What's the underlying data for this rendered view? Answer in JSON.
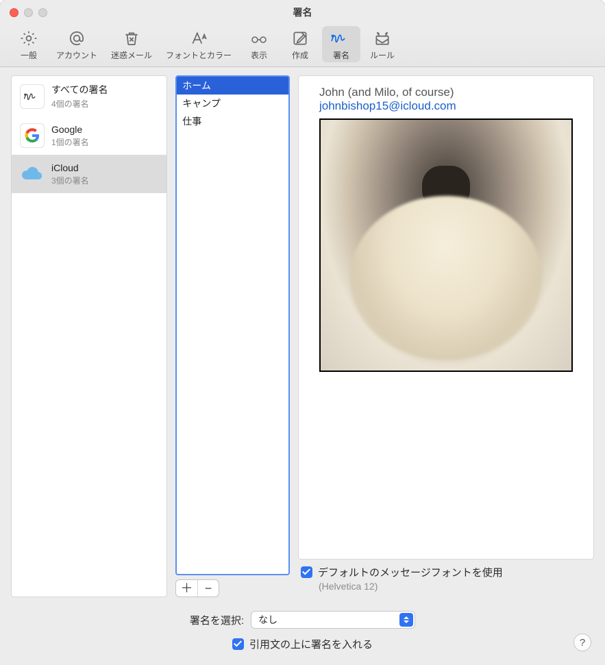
{
  "window": {
    "title": "署名"
  },
  "toolbar": {
    "items": [
      {
        "label": "一般"
      },
      {
        "label": "アカウント"
      },
      {
        "label": "迷惑メール"
      },
      {
        "label": "フォントとカラー"
      },
      {
        "label": "表示"
      },
      {
        "label": "作成"
      },
      {
        "label": "署名"
      },
      {
        "label": "ルール"
      }
    ],
    "selected_index": 6
  },
  "accounts": {
    "items": [
      {
        "name": "すべての署名",
        "subtitle": "4個の署名"
      },
      {
        "name": "Google",
        "subtitle": "1個の署名"
      },
      {
        "name": "iCloud",
        "subtitle": "3個の署名"
      }
    ],
    "selected_index": 2
  },
  "signatures": {
    "items": [
      "ホーム",
      "キャンプ",
      "仕事"
    ],
    "selected_index": 0
  },
  "preview": {
    "name_line": "John (and Milo, of course)",
    "email": "johnbishop15@icloud.com",
    "image_alt": "dog-photo"
  },
  "options": {
    "use_default_font_label": "デフォルトのメッセージフォントを使用",
    "use_default_font_checked": true,
    "default_font_note": "(Helvetica 12)"
  },
  "footer": {
    "select_label": "署名を選択:",
    "select_value": "なし",
    "above_quote_label": "引用文の上に署名を入れる",
    "above_quote_checked": true
  },
  "buttons": {
    "add": "＋",
    "remove": "−",
    "help": "?"
  }
}
